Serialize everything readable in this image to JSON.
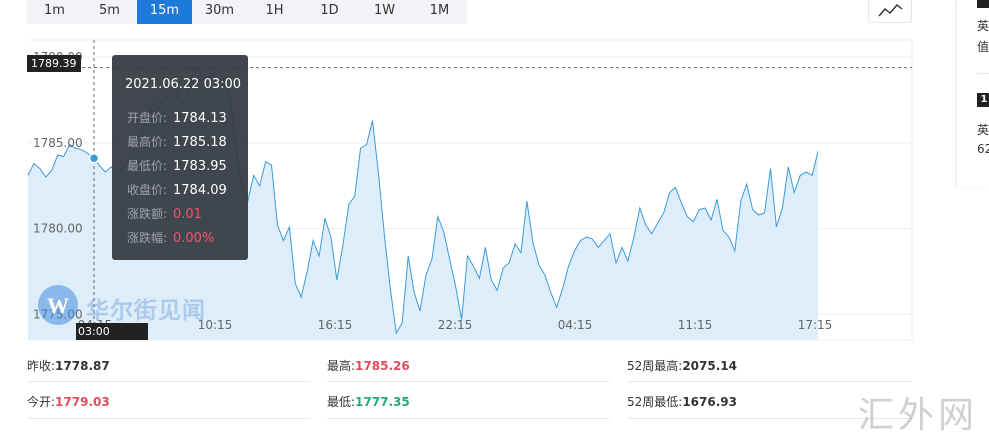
{
  "timeframe_tabs": [
    "1m",
    "5m",
    "15m",
    "30m",
    "1H",
    "1D",
    "1W",
    "1M"
  ],
  "active_tab": "15m",
  "chart_type_button_icon": "line-chart-icon",
  "chart_data": {
    "type": "area",
    "y_ticks": [
      "1790.00",
      "1785.00",
      "1780.00",
      "1775.00"
    ],
    "x_ticks": [
      "04:15",
      "10:15",
      "16:15",
      "22:15",
      "04:15",
      "11:15",
      "17:15"
    ],
    "ylim": [
      1773.5,
      1791
    ],
    "crosshair": {
      "time": "03:00",
      "price": "1789.39"
    },
    "line_color": "#3d9ad9",
    "fill_color": "#ddedfa",
    "values": [
      1783.1,
      1783.8,
      1783.5,
      1783.0,
      1783.4,
      1784.3,
      1784.2,
      1784.9,
      1784.7,
      1784.6,
      1784.4,
      1784.1,
      1783.7,
      1783.3,
      1783.6,
      1783.2,
      1783.5,
      1784.0,
      1784.8,
      1785.6,
      1786.4,
      1787.3,
      1787.0,
      1787.8,
      1787.4,
      1788.0,
      1787.2,
      1788.1,
      1789.4,
      1789.1,
      1788.7,
      1789.0,
      1788.4,
      1788.8,
      1787.6,
      1784.8,
      1782.6,
      1781.6,
      1783.1,
      1782.5,
      1783.9,
      1783.7,
      1780.2,
      1779.3,
      1780.1,
      1776.8,
      1776.0,
      1777.5,
      1779.3,
      1778.4,
      1780.6,
      1779.5,
      1777.0,
      1779.0,
      1781.4,
      1781.9,
      1784.7,
      1784.9,
      1786.3,
      1783.2,
      1779.6,
      1776.5,
      1773.9,
      1774.5,
      1778.4,
      1776.3,
      1775.2,
      1777.3,
      1778.2,
      1780.7,
      1779.8,
      1778.2,
      1776.6,
      1774.7,
      1778.4,
      1777.8,
      1777.1,
      1778.9,
      1777.0,
      1776.4,
      1777.7,
      1778.0,
      1779.1,
      1778.6,
      1781.6,
      1779.2,
      1777.9,
      1777.3,
      1776.3,
      1775.4,
      1776.5,
      1777.8,
      1778.7,
      1779.3,
      1779.5,
      1779.4,
      1778.9,
      1779.3,
      1779.7,
      1778.0,
      1778.9,
      1778.1,
      1779.5,
      1781.2,
      1780.2,
      1779.7,
      1780.3,
      1780.9,
      1782.1,
      1782.4,
      1781.5,
      1780.7,
      1780.4,
      1781.1,
      1781.2,
      1780.5,
      1781.7,
      1779.9,
      1779.5,
      1778.7,
      1781.6,
      1782.6,
      1781.1,
      1780.8,
      1780.9,
      1783.5,
      1780.1,
      1781.2,
      1783.6,
      1782.1,
      1783.1,
      1783.3,
      1783.1,
      1784.5
    ]
  },
  "tooltip": {
    "date": "2021.06.22 03:00",
    "rows": [
      {
        "label": "开盘价:",
        "value": "1784.13"
      },
      {
        "label": "最高价:",
        "value": "1785.18"
      },
      {
        "label": "最低价:",
        "value": "1783.95"
      },
      {
        "label": "收盘价:",
        "value": "1784.09"
      },
      {
        "label": "涨跌额:",
        "value": "0.01"
      },
      {
        "label": "涨跌幅:",
        "value": "0.00%"
      }
    ]
  },
  "stats": {
    "prev_close": {
      "label": "昨收:",
      "value": "1778.87"
    },
    "open": {
      "label": "今开:",
      "value": "1779.03"
    },
    "high": {
      "label": "最高:",
      "value": "1785.26"
    },
    "low": {
      "label": "最低:",
      "value": "1777.35"
    },
    "high_52w": {
      "label": "52周最高:",
      "value": "2075.14"
    },
    "low_52w": {
      "label": "52周最低:",
      "value": "1676.93"
    }
  },
  "watermark": {
    "brand": "华尔街见闻",
    "site": "汇外网"
  },
  "right_panel": {
    "line1": "英",
    "line2": "值",
    "badge": "1",
    "line3": "英",
    "line4": "62"
  },
  "colors": {
    "accent": "#1e7ad8",
    "up": "#e44b5a",
    "down": "#27a77a",
    "line": "#3d9ad9"
  }
}
